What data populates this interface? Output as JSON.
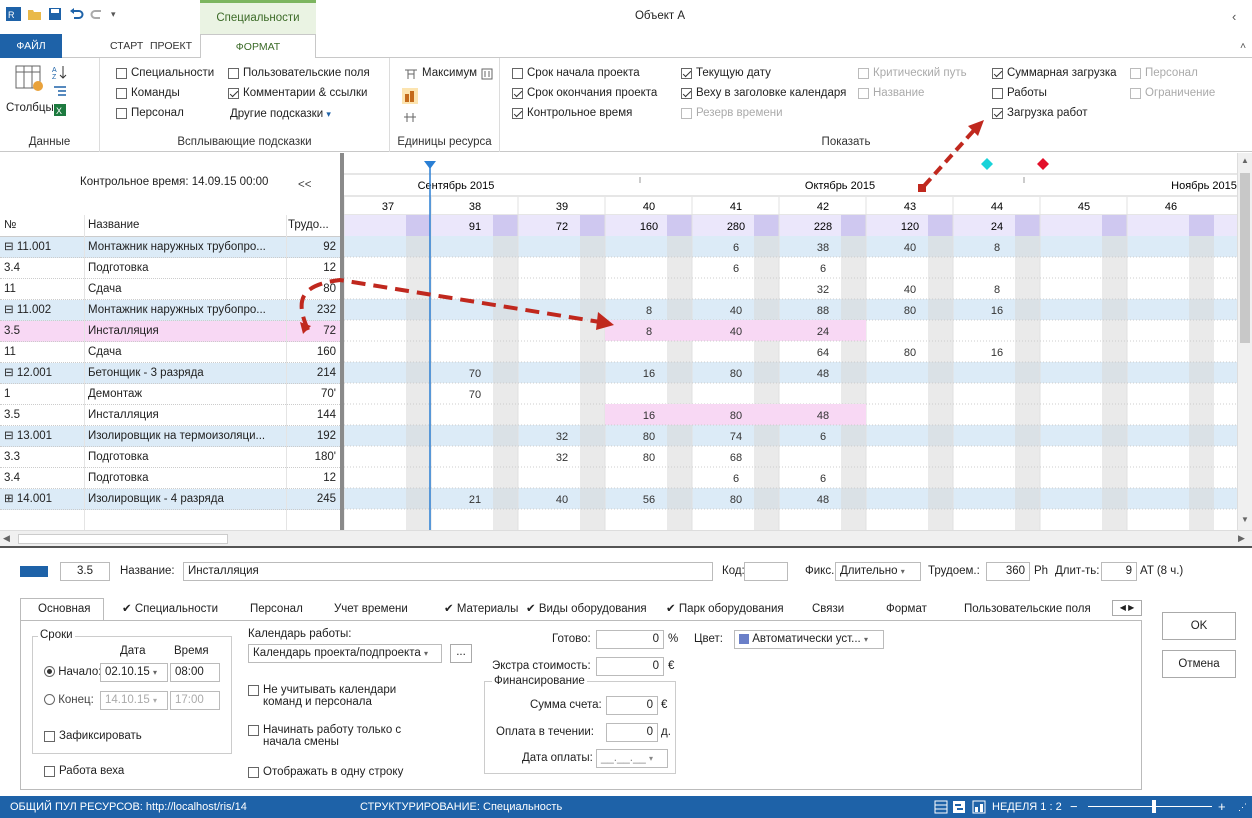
{
  "window": {
    "title": "Объект А",
    "context_tab": "Специальности"
  },
  "tabs": [
    "ФАЙЛ",
    "СТАРТ",
    "ПРОЕКТ",
    "ФОРМАТ"
  ],
  "ribbon": {
    "data_group": {
      "columns_label": "Столбцы",
      "label": "Данные"
    },
    "tooltips_group": {
      "label": "Всплывающие подсказки",
      "checks": [
        {
          "label": "Специальности",
          "checked": false
        },
        {
          "label": "Команды",
          "checked": false
        },
        {
          "label": "Персонал",
          "checked": false
        },
        {
          "label": "Пользовательские поля",
          "checked": false
        },
        {
          "label": "Комментарии & ссылки",
          "checked": true
        }
      ],
      "other": "Другие подсказки"
    },
    "units_group": {
      "label": "Единицы ресурса",
      "max_label": "Максимум"
    },
    "show_group": {
      "label": "Показать",
      "checks": [
        {
          "label": "Срок начала проекта",
          "checked": false,
          "disabled": false
        },
        {
          "label": "Срок окончания проекта",
          "checked": true,
          "disabled": false
        },
        {
          "label": "Контрольное время",
          "checked": true,
          "disabled": false
        },
        {
          "label": "Текущую дату",
          "checked": true,
          "disabled": false
        },
        {
          "label": "Веху в заголовке календаря",
          "checked": true,
          "disabled": false
        },
        {
          "label": "Резерв времени",
          "checked": false,
          "disabled": true
        },
        {
          "label": "Критический путь",
          "checked": false,
          "disabled": true
        },
        {
          "label": "Название",
          "checked": false,
          "disabled": true
        },
        {
          "label": "Суммарная загрузка",
          "checked": true,
          "disabled": false
        },
        {
          "label": "Работы",
          "checked": false,
          "disabled": false
        },
        {
          "label": "Загрузка работ",
          "checked": true,
          "disabled": false
        },
        {
          "label": "Персонал",
          "checked": false,
          "disabled": true
        },
        {
          "label": "Ограничение",
          "checked": false,
          "disabled": true
        }
      ]
    }
  },
  "grid": {
    "control_time": "Контрольное время: 14.09.15 00:00",
    "collapse": "<<",
    "headers": {
      "num": "№",
      "name": "Название",
      "labor": "Трудо..."
    },
    "months": [
      "Сентябрь 2015",
      "Октябрь 2015",
      "Ноябрь 2015"
    ],
    "weeks": [
      "37",
      "38",
      "39",
      "40",
      "41",
      "42",
      "43",
      "44",
      "45",
      "46"
    ],
    "totals": [
      "",
      "91",
      "72",
      "160",
      "280",
      "228",
      "120",
      "24",
      "",
      ""
    ],
    "rows": [
      {
        "num": "⊟ 11.001",
        "name": "Монтажник наружных трубопро...",
        "labor": "92",
        "type": "group",
        "vals": [
          "",
          "",
          "",
          "",
          "6",
          "38",
          "40",
          "8",
          "",
          ""
        ]
      },
      {
        "num": "3.4",
        "name": "Подготовка",
        "labor": "12",
        "type": "task",
        "vals": [
          "",
          "",
          "",
          "",
          "6",
          "6",
          "",
          "",
          "",
          ""
        ]
      },
      {
        "num": "11",
        "name": "Сдача",
        "labor": "80",
        "type": "task",
        "vals": [
          "",
          "",
          "",
          "",
          "",
          "32",
          "40",
          "8",
          "",
          ""
        ]
      },
      {
        "num": "⊟ 11.002",
        "name": "Монтажник наружных трубопро...",
        "labor": "232",
        "type": "group",
        "vals": [
          "",
          "",
          "",
          "8",
          "40",
          "88",
          "80",
          "16",
          "",
          ""
        ]
      },
      {
        "num": "3.5",
        "name": "Инсталляция",
        "labor": "72",
        "type": "selected",
        "vals": [
          "",
          "",
          "",
          "8",
          "40",
          "24",
          "",
          "",
          "",
          ""
        ]
      },
      {
        "num": "11",
        "name": "Сдача",
        "labor": "160",
        "type": "task",
        "vals": [
          "",
          "",
          "",
          "",
          "",
          "64",
          "80",
          "16",
          "",
          ""
        ]
      },
      {
        "num": "⊟ 12.001",
        "name": "Бетонщик - 3 разряда",
        "labor": "214",
        "type": "group",
        "vals": [
          "",
          "70",
          "",
          "16",
          "80",
          "48",
          "",
          "",
          "",
          ""
        ]
      },
      {
        "num": "1",
        "name": "Демонтаж",
        "labor": "70'",
        "type": "task",
        "vals": [
          "",
          "70",
          "",
          "",
          "",
          "",
          "",
          "",
          "",
          ""
        ]
      },
      {
        "num": "3.5",
        "name": "Инсталляция",
        "labor": "144",
        "type": "pink",
        "vals": [
          "",
          "",
          "",
          "16",
          "80",
          "48",
          "",
          "",
          "",
          ""
        ]
      },
      {
        "num": "⊟ 13.001",
        "name": "Изолировщик на термоизоляци...",
        "labor": "192",
        "type": "group",
        "vals": [
          "",
          "",
          "32",
          "80",
          "74",
          "6",
          "",
          "",
          "",
          ""
        ]
      },
      {
        "num": "3.3",
        "name": "Подготовка",
        "labor": "180'",
        "type": "task",
        "vals": [
          "",
          "",
          "32",
          "80",
          "68",
          "",
          "",
          "",
          "",
          ""
        ]
      },
      {
        "num": "3.4",
        "name": "Подготовка",
        "labor": "12",
        "type": "task",
        "vals": [
          "",
          "",
          "",
          "",
          "6",
          "6",
          "",
          "",
          "",
          ""
        ]
      },
      {
        "num": "⊞ 14.001",
        "name": "Изолировщик - 4 разряда",
        "labor": "245",
        "type": "group",
        "vals": [
          "",
          "21",
          "40",
          "56",
          "80",
          "48",
          "",
          "",
          "",
          ""
        ]
      }
    ]
  },
  "details": {
    "id": "3.5",
    "name_label": "Название:",
    "name": "Инсталляция",
    "code_label": "Код:",
    "fix_label": "Фикс.",
    "fix_value": "Длительно",
    "labor_label": "Трудоем.:",
    "labor_value": "360",
    "labor_unit": "Ph",
    "dur_label": "Длит-ть:",
    "dur_value": "9",
    "dur_unit": "AT (8 ч.)",
    "tabs": [
      "Основная",
      "✔ Специальности",
      "Персонал",
      "Учет времени",
      "✔ Материалы",
      "✔ Виды оборудования",
      "✔ Парк оборудования",
      "Связи",
      "Формат",
      "Пользовательские поля"
    ],
    "terms": "Сроки",
    "date_label": "Дата",
    "time_label": "Время",
    "start_label": "Начало:",
    "start_date": "02.10.15",
    "start_time": "08:00",
    "end_label": "Конец:",
    "end_date": "14.10.15",
    "end_time": "17:00",
    "fixed": "Зафиксировать",
    "milestone": "Работа веха",
    "calendar_label": "Календарь работы:",
    "calendar_value": "Календарь проекта/подпроекта",
    "cal_btn": "...",
    "ignore_cal": "Не учитывать календари команд и персонала",
    "start_shift": "Начинать работу только с начала смены",
    "one_line": "Отображать в одну строку",
    "ready_label": "Готово:",
    "ready_value": "0",
    "ready_unit": "%",
    "extra_label": "Экстра стоимость:",
    "extra_value": "0",
    "currency": "€",
    "finance": "Финансирование",
    "invoice_label": "Сумма счета:",
    "invoice_value": "0",
    "pay_label": "Оплата в течении:",
    "pay_value": "0",
    "pay_unit": "д.",
    "paydate_label": "Дата оплаты:",
    "paydate_value": "__.__.__",
    "color_label": "Цвет:",
    "color_value": "Автоматически уст...",
    "ok": "OK",
    "cancel": "Отмена"
  },
  "status": {
    "pool": "ОБЩИЙ ПУЛ РЕСУРСОВ: http://localhost/ris/14",
    "struct": "СТРУКТУРИРОВАНИЕ: Специальность",
    "scale": "НЕДЕЛЯ 1 : 2"
  },
  "colors": {
    "accent": "#1e62a8",
    "group_row": "#dcebf7",
    "selected_row": "#f8d8f4",
    "total_row": "#cfc8f0",
    "weekend": "#d4d4d4",
    "arrow": "#c0281e"
  }
}
